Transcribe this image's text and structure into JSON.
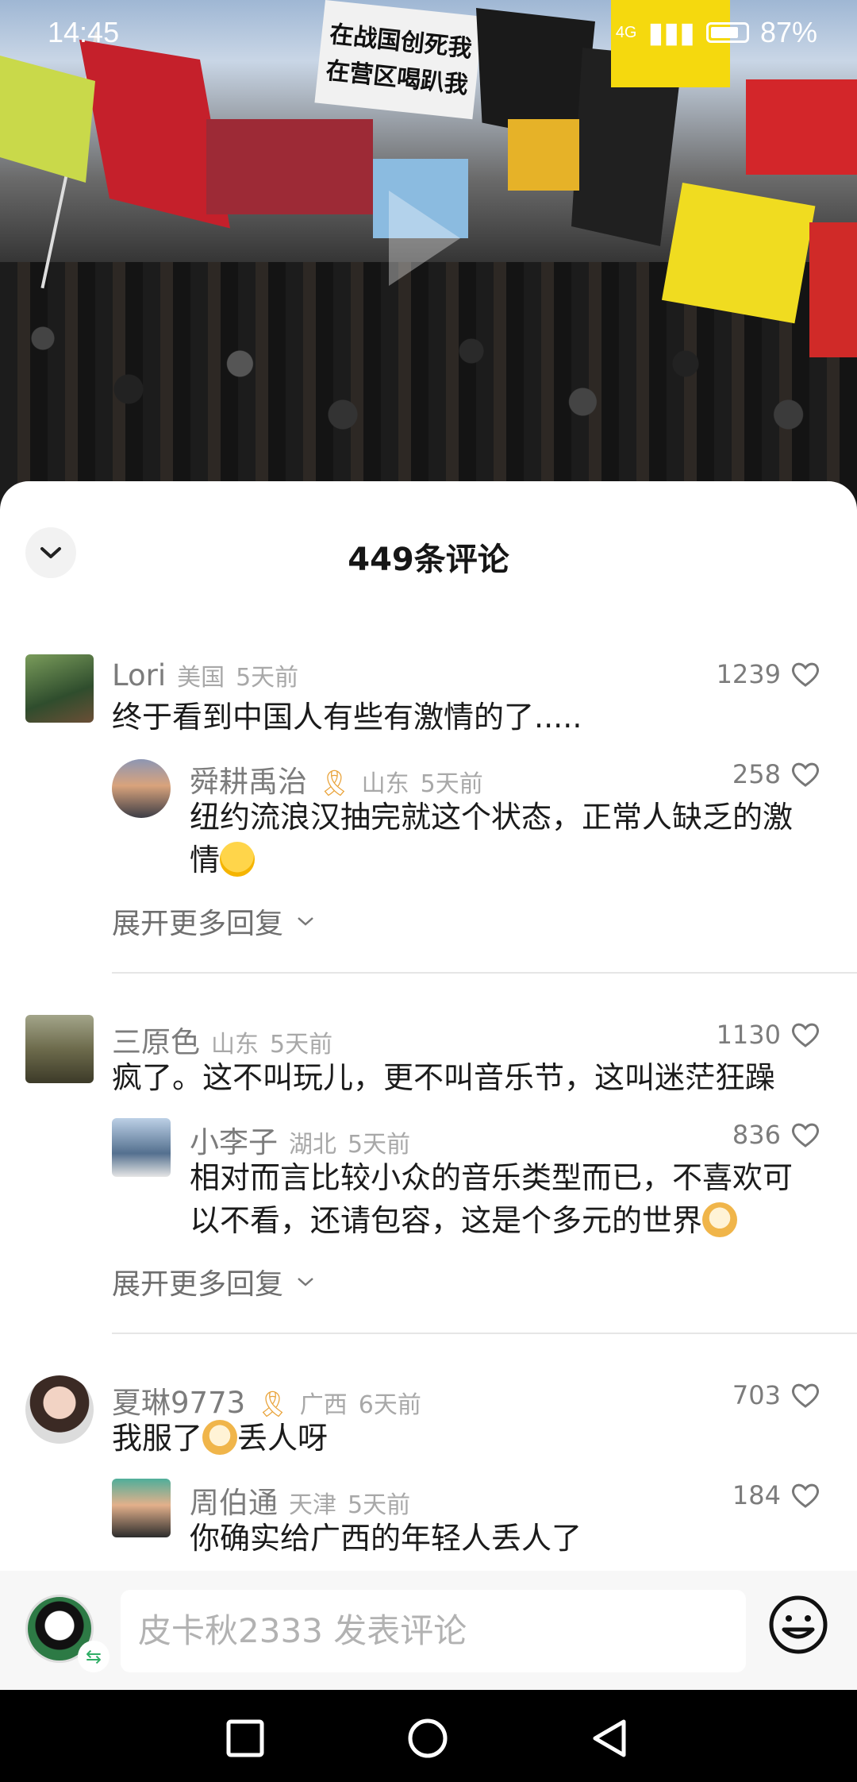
{
  "status": {
    "time": "14:45",
    "battery": "87%",
    "network": "4G"
  },
  "sheet": {
    "title": "449条评论"
  },
  "comments": [
    {
      "user": "Lori",
      "location": "美国",
      "time": "5天前",
      "likes": "1239",
      "text": "终于看到中国人有些有激情的了.....",
      "reply": {
        "user": "舜耕禹治",
        "location": "山东",
        "time": "5天前",
        "likes": "258",
        "line1": "纽约流浪汉抽完就这个状态，正常人缺乏的激",
        "line2": "情"
      },
      "expand": "展开更多回复"
    },
    {
      "user": "三原色",
      "location": "山东",
      "time": "5天前",
      "likes": "1130",
      "text": "疯了。这不叫玩儿，更不叫音乐节，这叫迷茫狂躁",
      "reply": {
        "user": "小李子",
        "location": "湖北",
        "time": "5天前",
        "likes": "836",
        "line1": "相对而言比较小众的音乐类型而已，不喜欢可",
        "line2": "以不看，还请包容，这是个多元的世界"
      },
      "expand": "展开更多回复"
    },
    {
      "user": "夏琳9773",
      "location": "广西",
      "time": "6天前",
      "likes": "703",
      "text_a": "我服了",
      "text_b": "丢人呀",
      "reply": {
        "user": "周伯通",
        "location": "天津",
        "time": "5天前",
        "likes": "184",
        "line1": "你确实给广西的年轻人丢人了"
      }
    }
  ],
  "input": {
    "placeholder": "皮卡秋2333 发表评论"
  },
  "video_banners": [
    "在战国创死我",
    "在营区喝趴我"
  ]
}
